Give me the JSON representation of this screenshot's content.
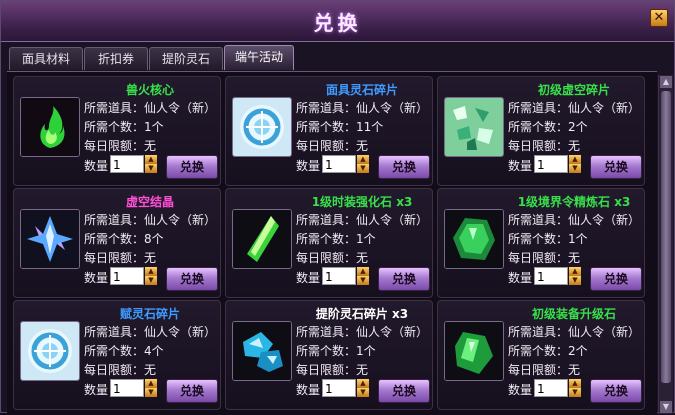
{
  "window": {
    "title": "兑换"
  },
  "tabs": [
    {
      "label": "面具材料"
    },
    {
      "label": "折扣券"
    },
    {
      "label": "提阶灵石"
    },
    {
      "label": "端午活动"
    }
  ],
  "labels": {
    "required_item": "所需道具：",
    "required_count": "所需个数：",
    "daily_limit": "每日限额：",
    "quantity": "数量",
    "exchange_button": "兑换"
  },
  "items": [
    {
      "name": "兽火核心",
      "name_color": "#37e04a",
      "required_item": "仙人令（新）",
      "required_count": "1个",
      "daily_limit": "无",
      "quantity": "1",
      "icon": "green-flame-icon"
    },
    {
      "name": "面具灵石碎片",
      "name_color": "#3f9bff",
      "required_item": "仙人令（新）",
      "required_count": "11个",
      "daily_limit": "无",
      "quantity": "1",
      "icon": "swirl-shard-icon"
    },
    {
      "name": "初级虚空碎片",
      "name_color": "#37e04a",
      "required_item": "仙人令（新）",
      "required_count": "2个",
      "daily_limit": "无",
      "quantity": "1",
      "icon": "void-shards-icon"
    },
    {
      "name": "虚空结晶",
      "name_color": "#ff4fd8",
      "required_item": "仙人令（新）",
      "required_count": "8个",
      "daily_limit": "无",
      "quantity": "1",
      "icon": "blue-crystal-icon"
    },
    {
      "name": "1级时装强化石 x3",
      "name_color": "#37e04a",
      "required_item": "仙人令（新）",
      "required_count": "1个",
      "daily_limit": "无",
      "quantity": "1",
      "icon": "green-crystal-icon"
    },
    {
      "name": "1级境界令精炼石 x3",
      "name_color": "#37e04a",
      "required_item": "仙人令（新）",
      "required_count": "1个",
      "daily_limit": "无",
      "quantity": "1",
      "icon": "emerald-stone-icon"
    },
    {
      "name": "赋灵石碎片",
      "name_color": "#3f9bff",
      "required_item": "仙人令（新）",
      "required_count": "4个",
      "daily_limit": "无",
      "quantity": "1",
      "icon": "swirl-shard-icon"
    },
    {
      "name": "提阶灵石碎片 x3",
      "name_color": "#ffffff",
      "required_item": "仙人令（新）",
      "required_count": "1个",
      "daily_limit": "无",
      "quantity": "1",
      "icon": "cyan-rock-icon"
    },
    {
      "name": "初级装备升级石",
      "name_color": "#37e04a",
      "required_item": "仙人令（新）",
      "required_count": "2个",
      "daily_limit": "无",
      "quantity": "1",
      "icon": "green-gem-icon"
    }
  ]
}
